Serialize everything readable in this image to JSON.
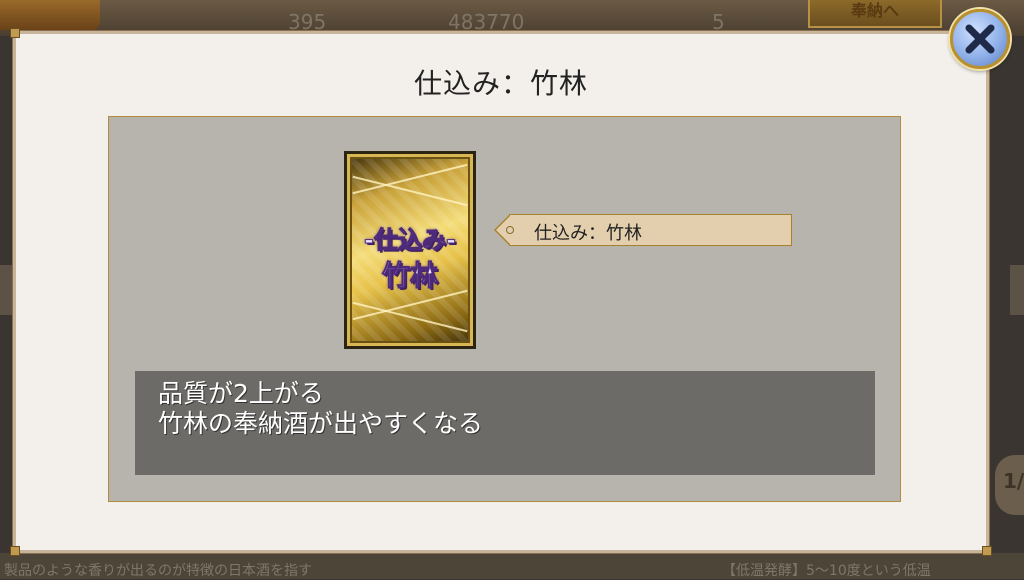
{
  "background": {
    "stats": [
      "395",
      "483770",
      "5"
    ],
    "offer_button": "奉納へ",
    "bottom_text_left": "製品のような香りが出るのが特徴の日本酒を指す",
    "bottom_text_right": "【低温発酵】5～10度という低温",
    "side_badge": "1/"
  },
  "modal": {
    "title": "仕込み：竹林",
    "card": {
      "line1": "-仕込み-",
      "line2": "竹林"
    },
    "name_tag": "仕込み：竹林",
    "description": [
      "品質が2上がる",
      "竹林の奉納酒が出やすくなる"
    ]
  },
  "close_button": {
    "icon": "close-icon"
  },
  "colors": {
    "modal_bg": "#f3f0ec",
    "panel_bg": "#b6b4ac",
    "desc_bg": "#6c6b67",
    "tag_bg": "#e3cfae",
    "gold": "#b08c3e"
  }
}
